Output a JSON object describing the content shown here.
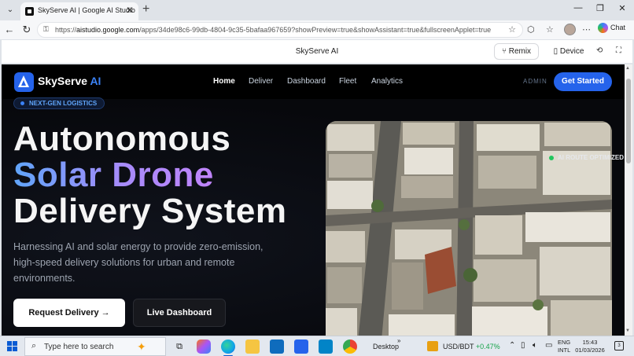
{
  "browser": {
    "tab_title": "SkyServe AI | Google AI Studio",
    "tab_close": "✕",
    "new_tab": "+",
    "url_prefix": "https://",
    "url_host": "aistudio.google.com",
    "url_path": "/apps/34de98c6-99db-4804-9c35-5bafaa967659?showPreview=true&showAssistant=true&fullscreenApplet=true",
    "chat_label": "Chat"
  },
  "studio": {
    "title": "SkyServe AI",
    "remix_label": "Remix",
    "device_label": "Device"
  },
  "app": {
    "brand_name": "SkyServe",
    "brand_ai": "AI",
    "nav": [
      "Home",
      "Deliver",
      "Dashboard",
      "Fleet",
      "Analytics"
    ],
    "admin_label": "ADMIN",
    "cta_label": "Get Started",
    "badge": "NEXT-GEN LOGISTICS",
    "headline_1": "Autonomous",
    "headline_2": "Solar Drone",
    "headline_3": "Delivery System",
    "subtext": "Harnessing AI and solar energy to provide zero-emission, high-speed delivery solutions for urban and remote environments.",
    "primary_button": "Request Delivery →",
    "secondary_button": "Live Dashboard",
    "image_tag": "AI ROUTE OPTIMIZED",
    "accent_color": "#2563eb"
  },
  "taskbar": {
    "search_placeholder": "Type here to search",
    "desktop_label": "Desktop",
    "ticker_name": "USD/BDT",
    "ticker_change": "+0.47%",
    "lang_1": "ENG",
    "lang_2": "INTL",
    "time": "15:43",
    "date": "01/03/2026"
  }
}
